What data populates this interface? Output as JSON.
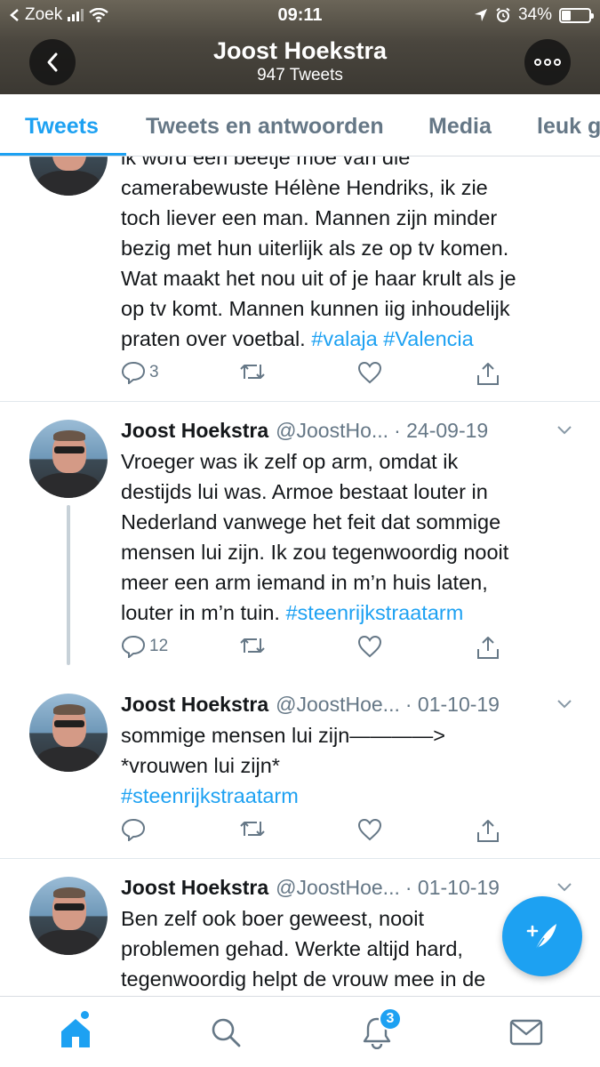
{
  "status_bar": {
    "carrier": "Zoek",
    "time": "09:11",
    "battery": "34%",
    "battery_level": 0.34
  },
  "header": {
    "title": "Joost Hoekstra",
    "subtitle": "947 Tweets",
    "back_icon": "chevron-left-icon",
    "more_icon": "more-icon"
  },
  "tabs": [
    {
      "label": "Tweets",
      "active": true
    },
    {
      "label": "Tweets en antwoorden",
      "active": false
    },
    {
      "label": "Media",
      "active": false
    },
    {
      "label": "leuk g",
      "active": false
    }
  ],
  "tweets": [
    {
      "text_line0": "ik word een beetje moe van die",
      "text": "camerabewuste Hélène Hendriks, ik zie\ntoch liever een man. Mannen zijn minder\nbezig met hun uiterlijk als ze op tv komen.\nWat maakt het nou uit of je haar krult als je\nop tv komt. Mannen kunnen iig inhoudelijk\npraten over voetbal. ",
      "tags": "#valaja #Valencia",
      "replies": "3"
    },
    {
      "name": "Joost Hoekstra",
      "handle": "@JoostHo...",
      "date": "· 24-09-19",
      "text": "Vroeger was ik zelf op arm, omdat ik\ndestijds lui was. Armoe bestaat louter in\nNederland vanwege het feit dat sommige\nmensen lui zijn. Ik zou tegenwoordig nooit\nmeer een arm iemand in m’n huis laten,\nlouter in m’n tuin.  ",
      "tags": "#steenrijkstraatarm",
      "replies": "12"
    },
    {
      "name": "Joost Hoekstra",
      "handle": "@JoostHoe...",
      "date": "· 01-10-19",
      "text": "sommige mensen lui zijn————>\n*vrouwen lui zijn*\n",
      "tags": "#steenrijkstraatarm",
      "replies": ""
    },
    {
      "name": "Joost Hoekstra",
      "handle": "@JoostHoe...",
      "date": "· 01-10-19",
      "text": "Ben zelf ook boer geweest, nooit\nproblemen gehad. Werkte altijd hard,\ntegenwoordig helpt de vrouw mee in de"
    }
  ],
  "notifications_badge": "3",
  "colors": {
    "accent": "#1da1f2",
    "text": "#14171a",
    "muted": "#657786"
  }
}
